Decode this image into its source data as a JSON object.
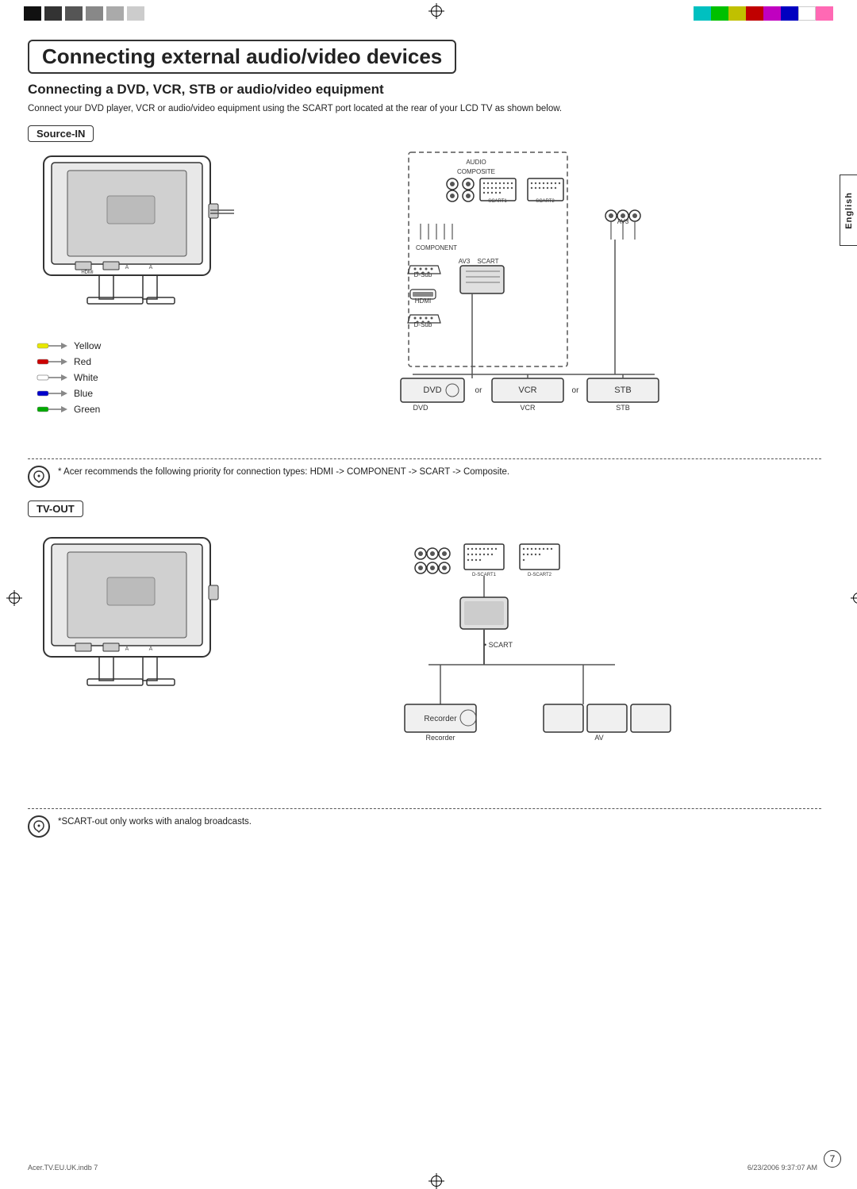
{
  "header": {
    "title": "Connecting external audio/video devices",
    "subtitle": "Connecting a DVD, VCR, STB or audio/video equipment",
    "intro": "Connect your DVD player, VCR or audio/video equipment using the SCART port located at the rear of your LCD TV as shown below."
  },
  "sections": {
    "source_in": {
      "label": "Source-IN"
    },
    "tv_out": {
      "label": "TV-OUT"
    }
  },
  "legend": {
    "items": [
      {
        "color": "#cccc00",
        "label": "Yellow"
      },
      {
        "color": "#cc0000",
        "label": "Red"
      },
      {
        "color": "#ffffff",
        "label": "White"
      },
      {
        "color": "#0000cc",
        "label": "Blue"
      },
      {
        "color": "#00aa00",
        "label": "Green"
      }
    ]
  },
  "note1": {
    "text": "*  Acer recommends the following priority for connection types:\n   HDMI -> COMPONENT -> SCART ->  Composite."
  },
  "note2": {
    "text": "*SCART-out only works with analog broadcasts."
  },
  "labels": {
    "audio": "AUDIO",
    "composite": "COMPOSITE",
    "component": "COMPONENT",
    "av3_1": "AV3",
    "scart": "SCART",
    "av3_2": "AV3",
    "dsub1": "D-Sub",
    "hdmi": "HDMI",
    "dsub2": "D-Sub",
    "dvd": "DVD",
    "vcr": "VCR",
    "stb": "STB",
    "or1": "or",
    "or2": "or",
    "scart_label": "• SCART",
    "recorder": "Recorder",
    "av": "AV"
  },
  "tab": {
    "language": "English"
  },
  "page": {
    "number": "7"
  },
  "footer": {
    "left": "Acer.TV.EU.UK.indb  7",
    "right": "6/23/2006  9:37:07 AM"
  },
  "color_bar": [
    "#00c0c0",
    "#00c000",
    "#c0c000",
    "#c00000",
    "#c000c0",
    "#0000c0",
    "#ffffff",
    "#ff69b4"
  ],
  "black_squares": [
    "#111",
    "#333",
    "#555",
    "#888",
    "#aaa",
    "#ccc"
  ]
}
